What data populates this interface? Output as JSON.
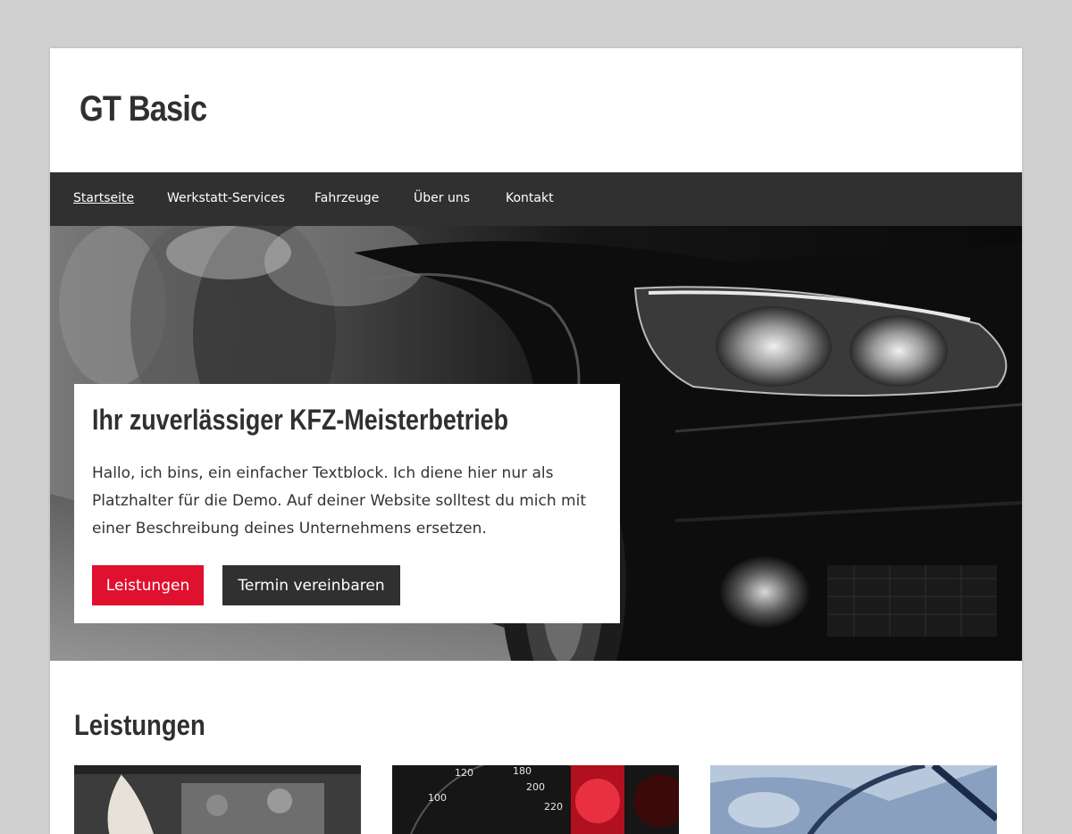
{
  "site": {
    "title": "GT Basic"
  },
  "nav": {
    "items": [
      {
        "label": "Startseite",
        "active": true
      },
      {
        "label": "Werkstatt-Services",
        "active": false
      },
      {
        "label": "Fahrzeuge",
        "active": false
      },
      {
        "label": "Über uns",
        "active": false
      },
      {
        "label": "Kontakt",
        "active": false
      }
    ]
  },
  "hero": {
    "image": "black-sports-car-headlight-photo",
    "heading": "Ihr zuverlässiger KFZ-Meisterbetrieb",
    "text": "Hallo, ich bins, ein einfacher Textblock. Ich diene hier nur als Platzhalter für die Demo. Auf deiner Website solltest du mich mit einer Beschreibung deines Unternehmens ersetzen.",
    "primary_button": "Leistungen",
    "secondary_button": "Termin vereinbaren"
  },
  "services": {
    "title": "Leistungen",
    "cards": [
      {
        "image": "engine-bay-photo"
      },
      {
        "image": "speedometer-photo"
      },
      {
        "image": "blue-car-photo"
      }
    ]
  },
  "colors": {
    "background": "#d0d0d0",
    "nav": "#303030",
    "accent": "#e0102f",
    "text": "#303030"
  }
}
